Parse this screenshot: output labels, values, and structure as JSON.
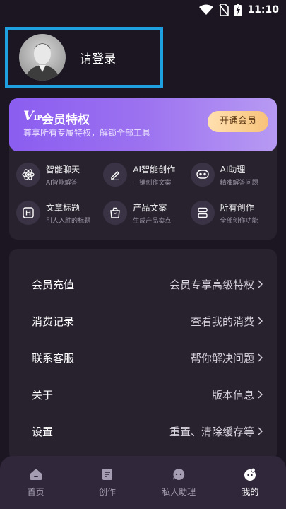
{
  "status": {
    "time": "11:10"
  },
  "profile": {
    "login_text": "请登录"
  },
  "vip": {
    "logo_v": "V",
    "logo_ip": "IP",
    "title": "会员特权",
    "subtitle": "尊享所有专属特权，解锁全部工具",
    "button": "开通会员"
  },
  "features": [
    {
      "title": "智能聊天",
      "sub": "AI智能解答",
      "icon": "atom-icon"
    },
    {
      "title": "AI智能创作",
      "sub": "一键创作文案",
      "icon": "pen-icon"
    },
    {
      "title": "AI助理",
      "sub": "精准解答问题",
      "icon": "chat-bubble-icon"
    },
    {
      "title": "文章标题",
      "sub": "引人入胜的标题",
      "icon": "heading-icon"
    },
    {
      "title": "产品文案",
      "sub": "生成产品卖点",
      "icon": "bag-icon"
    },
    {
      "title": "所有创作",
      "sub": "全部创作功能",
      "icon": "stack-icon"
    }
  ],
  "menu": [
    {
      "label": "会员充值",
      "value": "会员专享高级特权"
    },
    {
      "label": "消费记录",
      "value": "查看我的消费"
    },
    {
      "label": "联系客服",
      "value": "帮你解决问题"
    },
    {
      "label": "关于",
      "value": "版本信息"
    },
    {
      "label": "设置",
      "value": "重置、清除缓存等"
    }
  ],
  "tabs": [
    {
      "label": "首页",
      "icon": "home-icon"
    },
    {
      "label": "创作",
      "icon": "document-icon"
    },
    {
      "label": "私人助理",
      "icon": "assistant-icon"
    },
    {
      "label": "我的",
      "icon": "profile-icon",
      "active": true
    }
  ]
}
